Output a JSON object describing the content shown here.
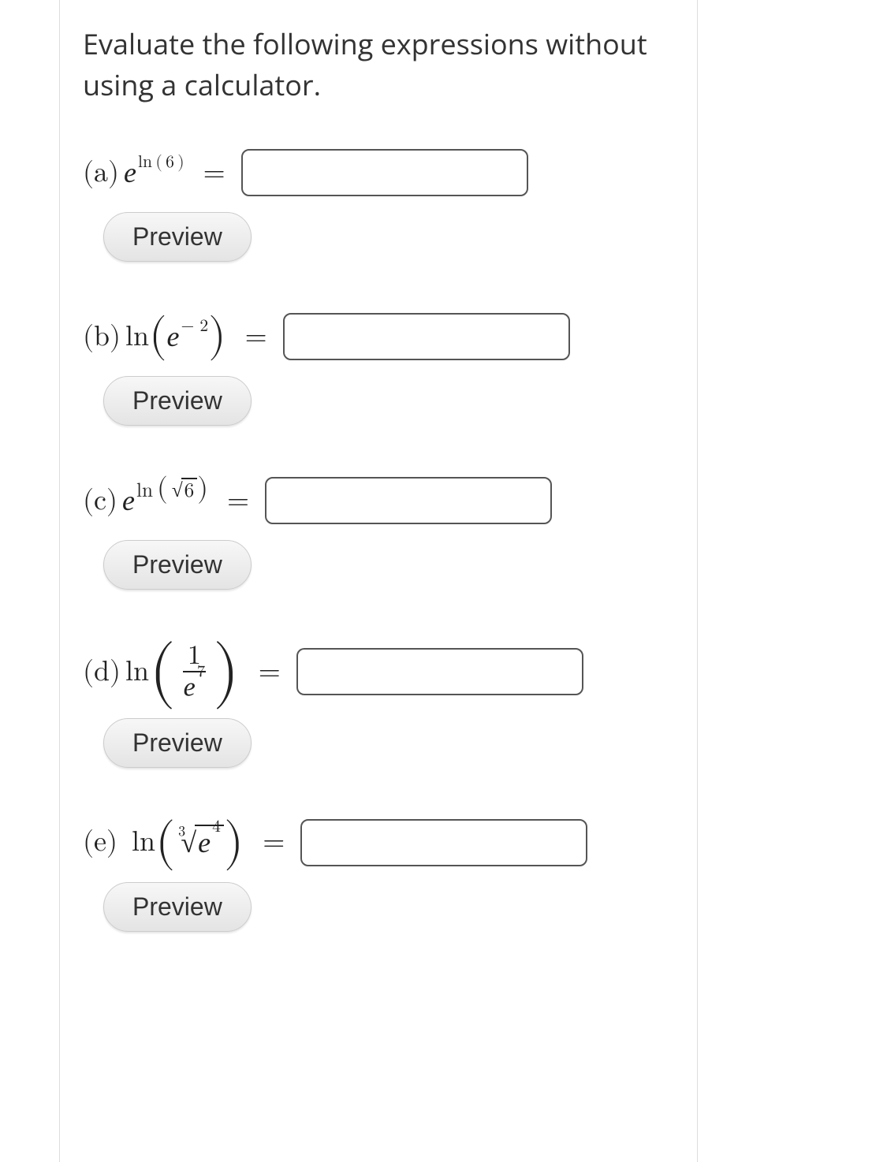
{
  "prompt": "Evaluate the following expressions without using a calculator.",
  "preview_label": "Preview",
  "parts": {
    "a": {
      "label": "(a)",
      "math": {
        "base": "e",
        "exp_prefix": "ln",
        "exp_arg_open": "(",
        "exp_arg": "6",
        "exp_arg_close": ")"
      },
      "answer": "",
      "input_width": 340
    },
    "b": {
      "label": "(b)",
      "math": {
        "fn": "ln",
        "open": "(",
        "inner_base": "e",
        "inner_exp": "− 2",
        "close": ")"
      },
      "answer": "",
      "input_width": 340
    },
    "c": {
      "label": "(c)",
      "math": {
        "base": "e",
        "exp_prefix": "ln",
        "open": "(",
        "sqrt_arg": "6",
        "close": ")"
      },
      "answer": "",
      "input_width": 340
    },
    "d": {
      "label": "(d)",
      "math": {
        "fn": "ln",
        "frac_num": "1",
        "frac_den_base": "e",
        "frac_den_exp": "7"
      },
      "answer": "",
      "input_width": 340
    },
    "e": {
      "label": "(e)",
      "math": {
        "fn": "ln",
        "root_index": "3",
        "rad_base": "e",
        "rad_exp": "4"
      },
      "answer": "",
      "input_width": 340
    }
  }
}
